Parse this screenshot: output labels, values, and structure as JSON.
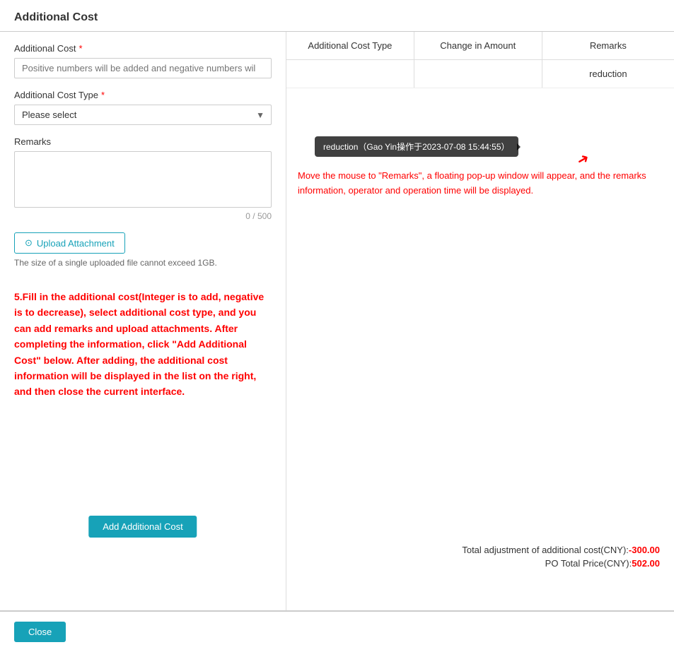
{
  "page": {
    "title": "Additional Cost"
  },
  "left": {
    "additional_cost_label": "Additional Cost",
    "additional_cost_placeholder": "Positive numbers will be added and negative numbers wil",
    "cost_type_label": "Additional Cost Type",
    "cost_type_placeholder": "Please select",
    "remarks_label": "Remarks",
    "remarks_counter": "0 / 500",
    "upload_btn": "Upload Attachment",
    "upload_hint": "The size of a single uploaded file cannot exceed 1GB.",
    "add_btn": "Add Additional Cost",
    "instruction": "5.Fill in the additional cost(Integer is to add, negative is to decrease), select additional cost type, and you can add remarks and upload attachments. After completing the information, click \"Add Additional Cost\" below. After adding, the additional cost information will be displayed in the list on the right, and then close the current interface."
  },
  "table": {
    "col1_header": "Additional Cost Type",
    "col2_header": "Change in Amount",
    "col3_header": "Remarks",
    "rows": [
      {
        "col1": "",
        "col2": "",
        "col3": "reduction"
      }
    ]
  },
  "tooltip": {
    "text": "reduction（Gao Yin操作于2023-07-08 15:44:55）"
  },
  "hover_instruction": "Move the mouse to \"Remarks\", a floating pop-up window will appear, and the remarks information, operator and operation time will be displayed.",
  "summary": {
    "adjustment_label": "Total adjustment of additional cost(CNY):",
    "adjustment_value": "-300.00",
    "po_total_label": "PO Total Price(CNY):",
    "po_total_value": "502.00"
  },
  "footer": {
    "close_btn": "Close"
  },
  "icons": {
    "upload": "⊙",
    "select_arrow": "▼"
  }
}
